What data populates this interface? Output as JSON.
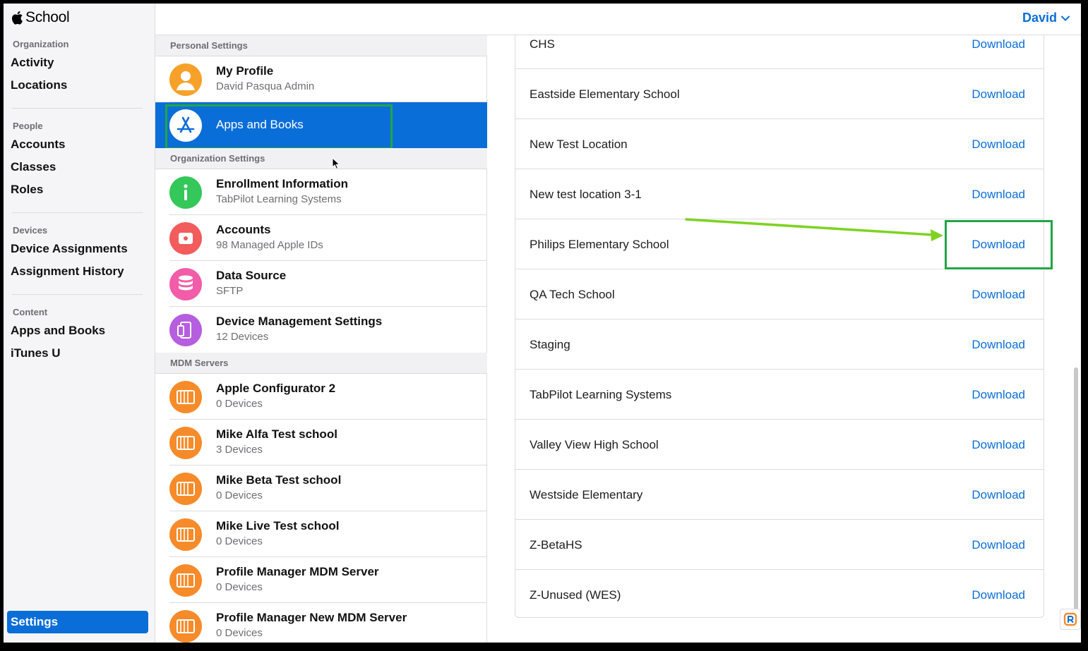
{
  "brand": {
    "name": "School",
    "logo_icon": "apple-logo-icon"
  },
  "sidebar": {
    "groups": [
      {
        "heading": "Organization",
        "items": [
          "Activity",
          "Locations"
        ]
      },
      {
        "heading": "People",
        "items": [
          "Accounts",
          "Classes",
          "Roles"
        ]
      },
      {
        "heading": "Devices",
        "items": [
          "Device Assignments",
          "Assignment History"
        ]
      },
      {
        "heading": "Content",
        "items": [
          "Apps and Books",
          "iTunes U"
        ]
      }
    ],
    "settings_label": "Settings"
  },
  "middle": {
    "personal_heading": "Personal Settings",
    "org_heading": "Organization Settings",
    "mdm_heading": "MDM Servers",
    "personal": [
      {
        "title": "My Profile",
        "subtitle": "David Pasqua Admin",
        "icon": "profile-icon",
        "color": "#f7a12a"
      },
      {
        "title": "Apps and Books",
        "subtitle": "",
        "icon": "app-store-icon",
        "color": "#0a6ed8"
      }
    ],
    "organization": [
      {
        "title": "Enrollment Information",
        "subtitle": "TabPilot Learning Systems",
        "icon": "info-icon",
        "color": "#34c759"
      },
      {
        "title": "Accounts",
        "subtitle": "98 Managed Apple IDs",
        "icon": "accounts-icon",
        "color": "#f25c5c"
      },
      {
        "title": "Data Source",
        "subtitle": "SFTP",
        "icon": "database-icon",
        "color": "#f25ca8"
      },
      {
        "title": "Device Management Settings",
        "subtitle": "12 Devices",
        "icon": "devices-icon",
        "color": "#b65ee0"
      }
    ],
    "mdm": [
      {
        "title": "Apple Configurator 2",
        "subtitle": "0 Devices",
        "icon": "server-icon",
        "color": "#f78b2a"
      },
      {
        "title": "Mike Alfa Test school",
        "subtitle": "3 Devices",
        "icon": "server-icon",
        "color": "#f78b2a"
      },
      {
        "title": "Mike Beta Test school",
        "subtitle": "0 Devices",
        "icon": "server-icon",
        "color": "#f78b2a"
      },
      {
        "title": "Mike Live Test school",
        "subtitle": "0 Devices",
        "icon": "server-icon",
        "color": "#f78b2a"
      },
      {
        "title": "Profile Manager MDM Server",
        "subtitle": "0 Devices",
        "icon": "server-icon",
        "color": "#f78b2a"
      },
      {
        "title": "Profile Manager New MDM Server",
        "subtitle": "0 Devices",
        "icon": "server-icon",
        "color": "#f78b2a"
      }
    ]
  },
  "topbar": {
    "user_name": "David"
  },
  "locations": [
    {
      "name": "CHS",
      "action": "Download"
    },
    {
      "name": "Eastside Elementary School",
      "action": "Download"
    },
    {
      "name": "New Test Location",
      "action": "Download"
    },
    {
      "name": "New test location 3-1",
      "action": "Download"
    },
    {
      "name": "Philips Elementary School",
      "action": "Download"
    },
    {
      "name": "QA Tech School",
      "action": "Download"
    },
    {
      "name": "Staging",
      "action": "Download"
    },
    {
      "name": "TabPilot Learning Systems",
      "action": "Download"
    },
    {
      "name": "Valley View High School",
      "action": "Download"
    },
    {
      "name": "Westside Elementary",
      "action": "Download"
    },
    {
      "name": "Z-BetaHS",
      "action": "Download"
    },
    {
      "name": "Z-Unused (WES)",
      "action": "Download"
    }
  ],
  "colors": {
    "accent": "#0a6ed8",
    "highlight": "#22a545",
    "arrow": "#7ed321"
  }
}
